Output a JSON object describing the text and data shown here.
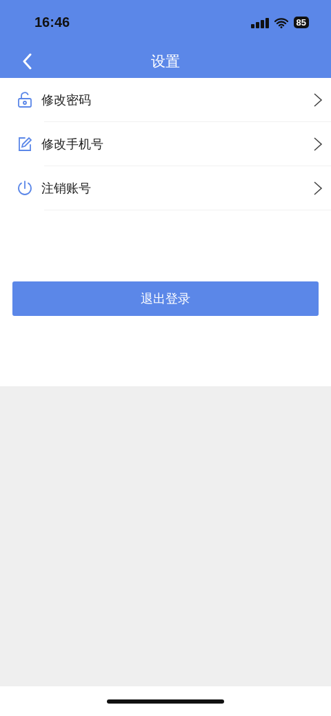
{
  "status_bar": {
    "time": "16:46",
    "battery": "85"
  },
  "nav": {
    "title": "设置"
  },
  "menu": [
    {
      "kind": "unlock",
      "label": "修改密码"
    },
    {
      "kind": "edit",
      "label": "修改手机号"
    },
    {
      "kind": "power",
      "label": "注销账号"
    }
  ],
  "logout_button": "退出登录"
}
